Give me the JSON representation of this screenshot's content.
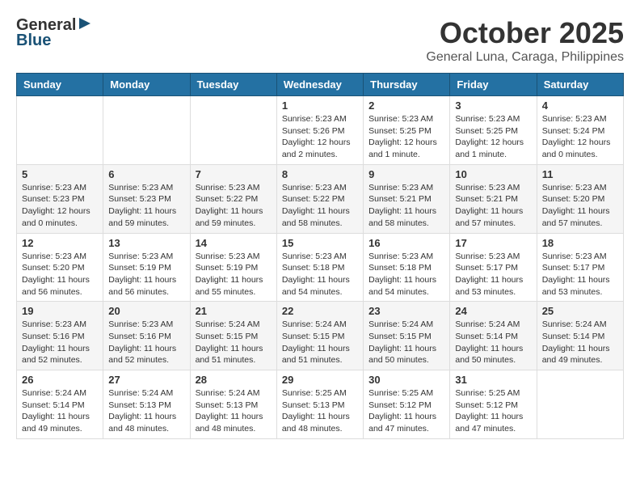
{
  "logo": {
    "general": "General",
    "blue": "Blue"
  },
  "title": "October 2025",
  "location": "General Luna, Caraga, Philippines",
  "weekdays": [
    "Sunday",
    "Monday",
    "Tuesday",
    "Wednesday",
    "Thursday",
    "Friday",
    "Saturday"
  ],
  "weeks": [
    [
      {
        "day": "",
        "info": ""
      },
      {
        "day": "",
        "info": ""
      },
      {
        "day": "",
        "info": ""
      },
      {
        "day": "1",
        "info": "Sunrise: 5:23 AM\nSunset: 5:26 PM\nDaylight: 12 hours and 2 minutes."
      },
      {
        "day": "2",
        "info": "Sunrise: 5:23 AM\nSunset: 5:25 PM\nDaylight: 12 hours and 1 minute."
      },
      {
        "day": "3",
        "info": "Sunrise: 5:23 AM\nSunset: 5:25 PM\nDaylight: 12 hours and 1 minute."
      },
      {
        "day": "4",
        "info": "Sunrise: 5:23 AM\nSunset: 5:24 PM\nDaylight: 12 hours and 0 minutes."
      }
    ],
    [
      {
        "day": "5",
        "info": "Sunrise: 5:23 AM\nSunset: 5:23 PM\nDaylight: 12 hours and 0 minutes."
      },
      {
        "day": "6",
        "info": "Sunrise: 5:23 AM\nSunset: 5:23 PM\nDaylight: 11 hours and 59 minutes."
      },
      {
        "day": "7",
        "info": "Sunrise: 5:23 AM\nSunset: 5:22 PM\nDaylight: 11 hours and 59 minutes."
      },
      {
        "day": "8",
        "info": "Sunrise: 5:23 AM\nSunset: 5:22 PM\nDaylight: 11 hours and 58 minutes."
      },
      {
        "day": "9",
        "info": "Sunrise: 5:23 AM\nSunset: 5:21 PM\nDaylight: 11 hours and 58 minutes."
      },
      {
        "day": "10",
        "info": "Sunrise: 5:23 AM\nSunset: 5:21 PM\nDaylight: 11 hours and 57 minutes."
      },
      {
        "day": "11",
        "info": "Sunrise: 5:23 AM\nSunset: 5:20 PM\nDaylight: 11 hours and 57 minutes."
      }
    ],
    [
      {
        "day": "12",
        "info": "Sunrise: 5:23 AM\nSunset: 5:20 PM\nDaylight: 11 hours and 56 minutes."
      },
      {
        "day": "13",
        "info": "Sunrise: 5:23 AM\nSunset: 5:19 PM\nDaylight: 11 hours and 56 minutes."
      },
      {
        "day": "14",
        "info": "Sunrise: 5:23 AM\nSunset: 5:19 PM\nDaylight: 11 hours and 55 minutes."
      },
      {
        "day": "15",
        "info": "Sunrise: 5:23 AM\nSunset: 5:18 PM\nDaylight: 11 hours and 54 minutes."
      },
      {
        "day": "16",
        "info": "Sunrise: 5:23 AM\nSunset: 5:18 PM\nDaylight: 11 hours and 54 minutes."
      },
      {
        "day": "17",
        "info": "Sunrise: 5:23 AM\nSunset: 5:17 PM\nDaylight: 11 hours and 53 minutes."
      },
      {
        "day": "18",
        "info": "Sunrise: 5:23 AM\nSunset: 5:17 PM\nDaylight: 11 hours and 53 minutes."
      }
    ],
    [
      {
        "day": "19",
        "info": "Sunrise: 5:23 AM\nSunset: 5:16 PM\nDaylight: 11 hours and 52 minutes."
      },
      {
        "day": "20",
        "info": "Sunrise: 5:23 AM\nSunset: 5:16 PM\nDaylight: 11 hours and 52 minutes."
      },
      {
        "day": "21",
        "info": "Sunrise: 5:24 AM\nSunset: 5:15 PM\nDaylight: 11 hours and 51 minutes."
      },
      {
        "day": "22",
        "info": "Sunrise: 5:24 AM\nSunset: 5:15 PM\nDaylight: 11 hours and 51 minutes."
      },
      {
        "day": "23",
        "info": "Sunrise: 5:24 AM\nSunset: 5:15 PM\nDaylight: 11 hours and 50 minutes."
      },
      {
        "day": "24",
        "info": "Sunrise: 5:24 AM\nSunset: 5:14 PM\nDaylight: 11 hours and 50 minutes."
      },
      {
        "day": "25",
        "info": "Sunrise: 5:24 AM\nSunset: 5:14 PM\nDaylight: 11 hours and 49 minutes."
      }
    ],
    [
      {
        "day": "26",
        "info": "Sunrise: 5:24 AM\nSunset: 5:14 PM\nDaylight: 11 hours and 49 minutes."
      },
      {
        "day": "27",
        "info": "Sunrise: 5:24 AM\nSunset: 5:13 PM\nDaylight: 11 hours and 48 minutes."
      },
      {
        "day": "28",
        "info": "Sunrise: 5:24 AM\nSunset: 5:13 PM\nDaylight: 11 hours and 48 minutes."
      },
      {
        "day": "29",
        "info": "Sunrise: 5:25 AM\nSunset: 5:13 PM\nDaylight: 11 hours and 48 minutes."
      },
      {
        "day": "30",
        "info": "Sunrise: 5:25 AM\nSunset: 5:12 PM\nDaylight: 11 hours and 47 minutes."
      },
      {
        "day": "31",
        "info": "Sunrise: 5:25 AM\nSunset: 5:12 PM\nDaylight: 11 hours and 47 minutes."
      },
      {
        "day": "",
        "info": ""
      }
    ]
  ]
}
